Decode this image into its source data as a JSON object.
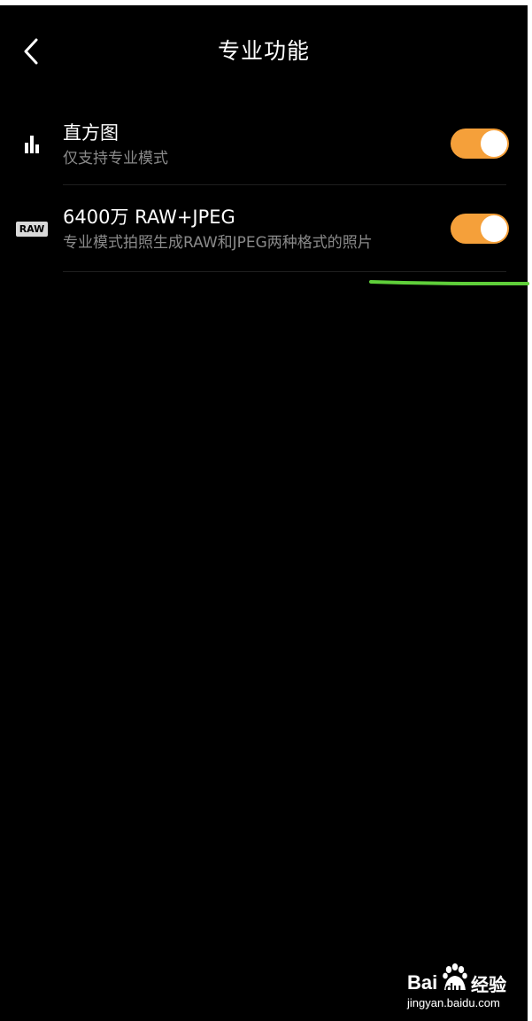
{
  "header": {
    "title": "专业功能",
    "back_icon": "chevron-left-icon"
  },
  "settings": [
    {
      "icon": "histogram-icon",
      "title": "直方图",
      "subtitle": "仅支持专业模式",
      "enabled": true
    },
    {
      "icon": "raw-badge-icon",
      "icon_text": "RAW",
      "title": "6400万 RAW+JPEG",
      "subtitle": "专业模式拍照生成RAW和JPEG两种格式的照片",
      "enabled": true
    }
  ],
  "colors": {
    "background": "#000000",
    "toggle_on": "#f5a03a",
    "knob": "#ffffff",
    "annotation": "#5fcf3a"
  },
  "watermark": {
    "brand_bai": "Bai",
    "brand_du": "du",
    "brand_jingyan": "经验",
    "url": "jingyan.baidu.com"
  }
}
